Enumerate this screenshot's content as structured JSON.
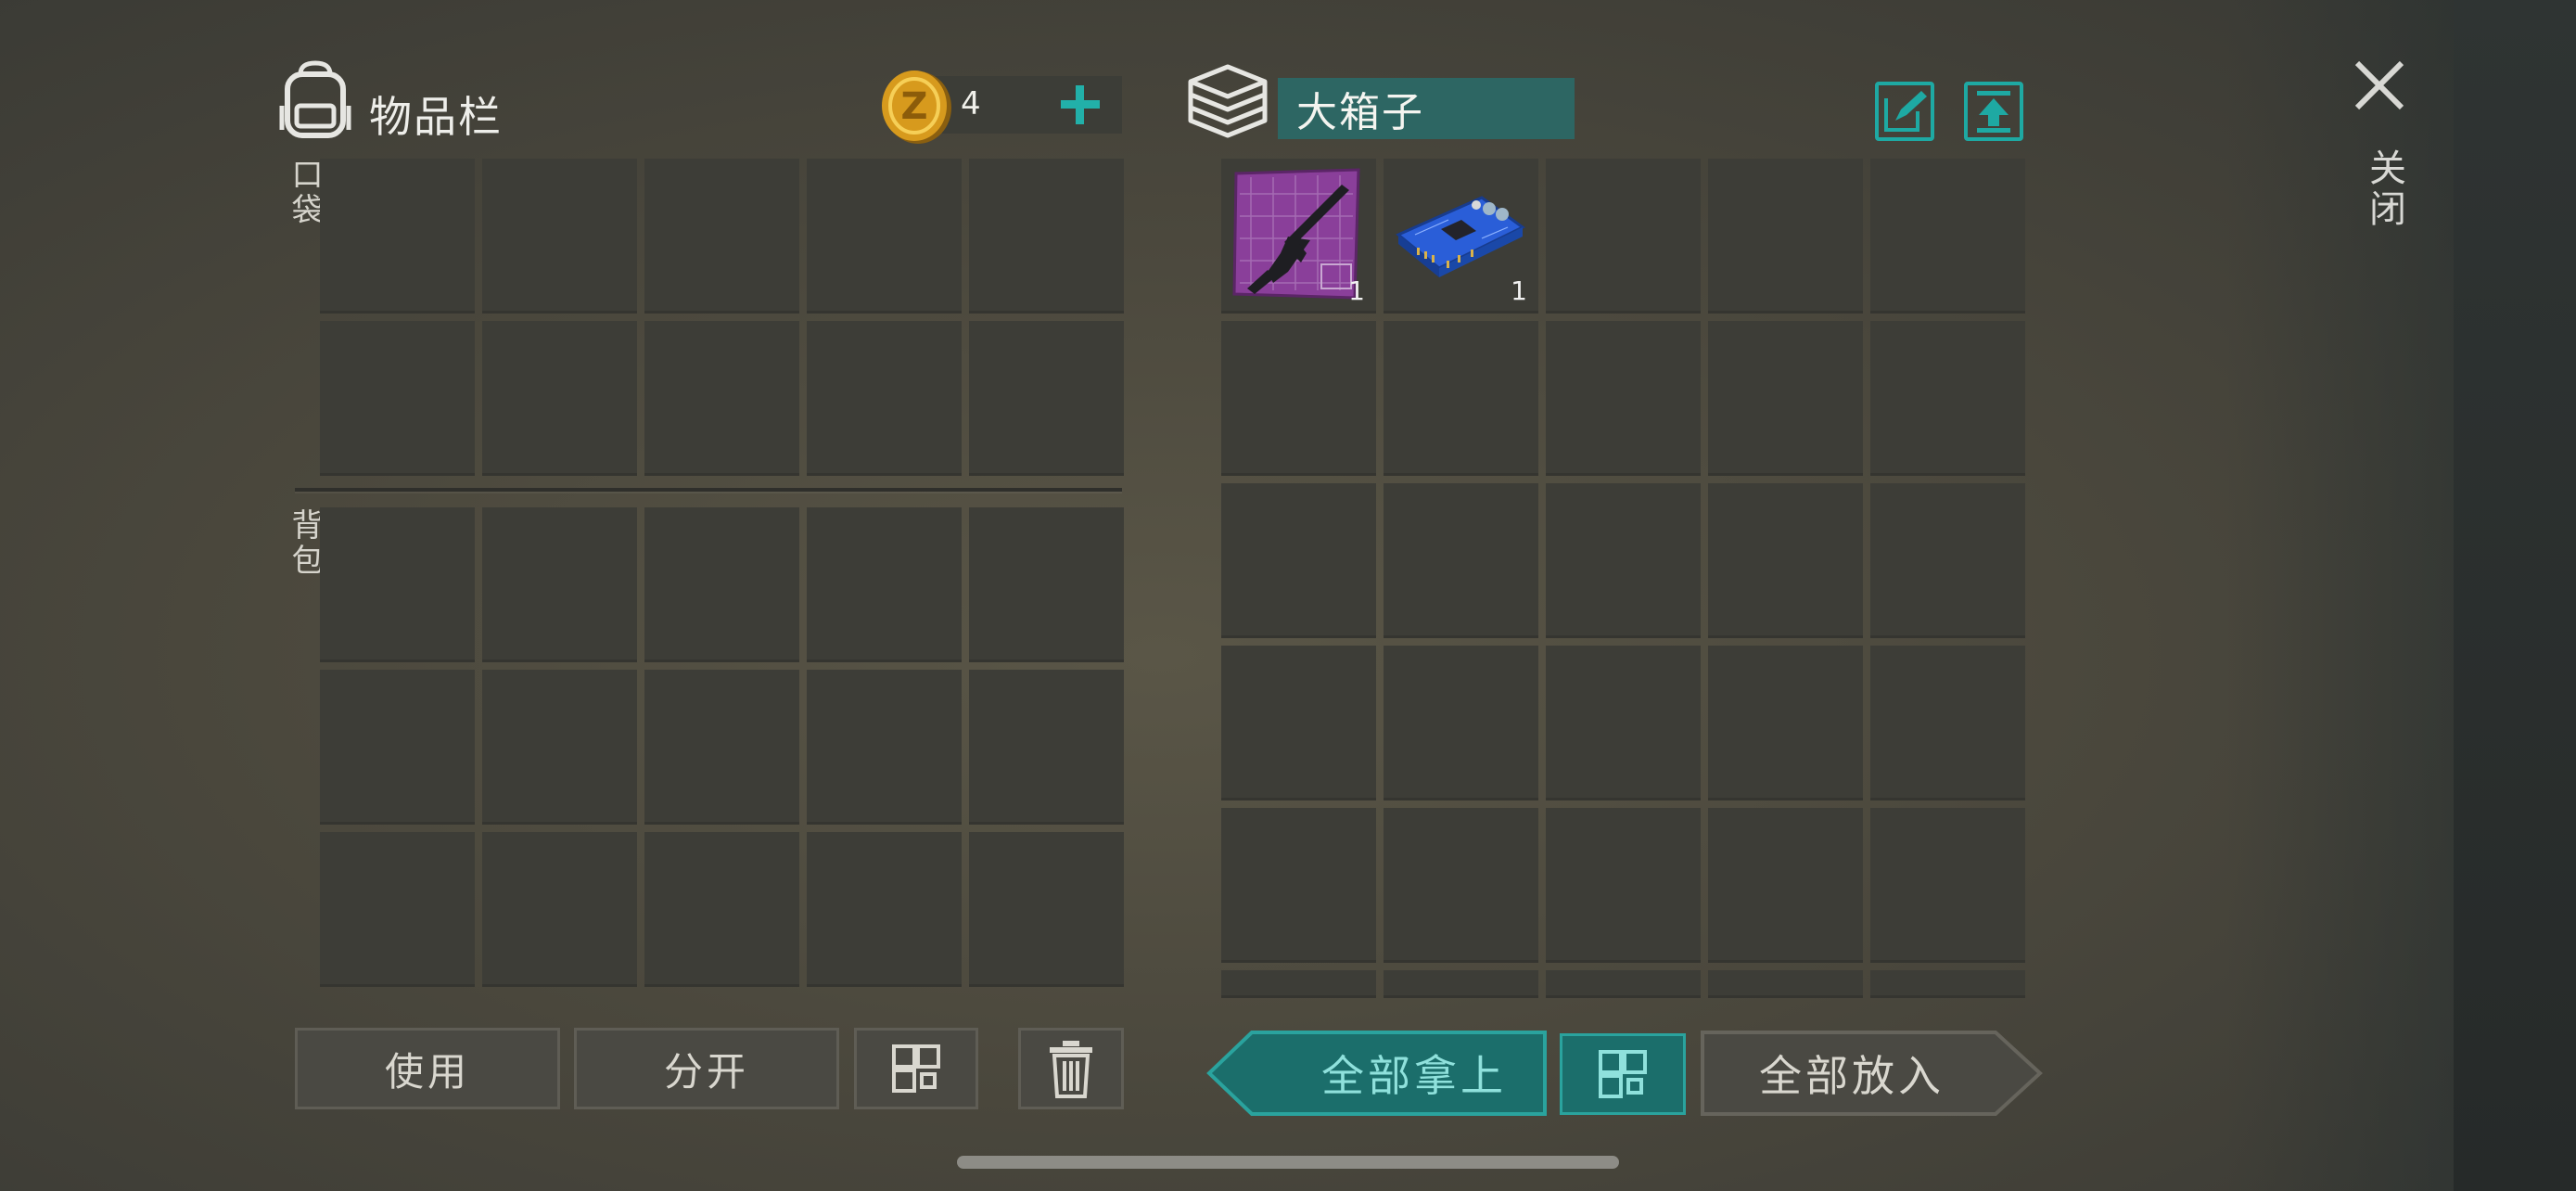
{
  "inventory": {
    "title": "物品栏",
    "coins": "4",
    "pocket_label": "口袋",
    "backpack_label": "背包"
  },
  "container": {
    "name": "大箱子",
    "items": [
      {
        "name": "rifle-blueprint",
        "qty": "1"
      },
      {
        "name": "circuit-board",
        "qty": "1"
      }
    ]
  },
  "close": {
    "label": "关闭"
  },
  "buttons": {
    "use": "使用",
    "split": "分开",
    "take_all": "全部拿上",
    "put_all": "全部放入"
  },
  "colors": {
    "accent": "#1ea9a3",
    "teal_button": "#1b6e6b",
    "slot": "#3d3d37"
  }
}
